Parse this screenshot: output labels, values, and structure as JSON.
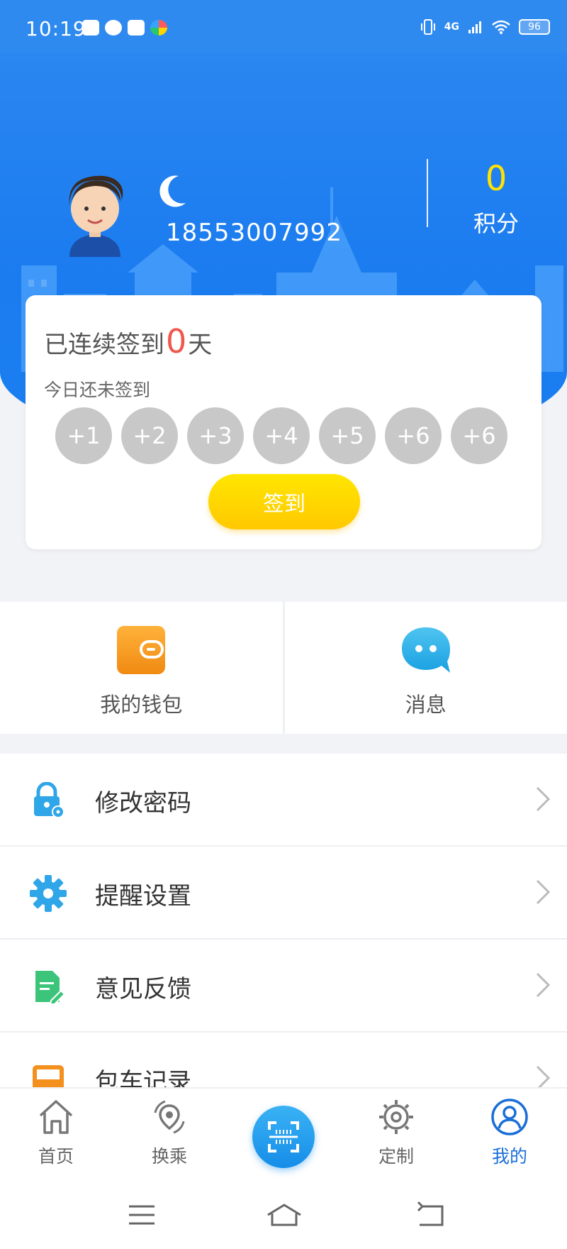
{
  "status_bar": {
    "time": "10:19",
    "network": "4G",
    "battery": "96"
  },
  "header": {
    "phone": "18553007992",
    "points_value": "0",
    "points_label": "积分"
  },
  "signin": {
    "streak_prefix": "已连续签到",
    "streak_days": "0",
    "streak_suffix": "天",
    "today_status": "今日还未签到",
    "days": [
      "+1",
      "+2",
      "+3",
      "+4",
      "+5",
      "+6",
      "+6"
    ],
    "button_label": "签到"
  },
  "quick": {
    "wallet_label": "我的钱包",
    "message_label": "消息"
  },
  "menu": {
    "items": [
      {
        "label": "修改密码",
        "icon": "lock-icon"
      },
      {
        "label": "提醒设置",
        "icon": "gear-icon"
      },
      {
        "label": "意见反馈",
        "icon": "feedback-icon"
      },
      {
        "label": "包车记录",
        "icon": "bus-icon"
      }
    ]
  },
  "tabbar": {
    "home": "首页",
    "transfer": "换乘",
    "custom": "定制",
    "mine": "我的"
  },
  "colors": {
    "primary_blue": "#1b7cf0",
    "points_yellow": "#ffe300",
    "streak_red": "#f0564a",
    "signin_button": "#ffd400",
    "active_tab": "#1a6fd8"
  }
}
